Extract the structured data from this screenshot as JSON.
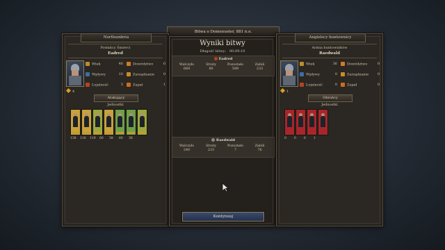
{
  "header": {
    "battle_title": "Bitwa o Domenuster, 881 n.e."
  },
  "left": {
    "faction": "Northumbria",
    "army": "Posłańcy Śmierci",
    "general": "Eadred",
    "stats": [
      {
        "icon": "age-icon",
        "label": "Wiek",
        "value": "46",
        "color": "#b8902f"
      },
      {
        "icon": "influence-icon",
        "label": "Wpływy",
        "value": "10",
        "color": "#3b6fa6"
      },
      {
        "icon": "loyalty-icon",
        "label": "Lojalność",
        "value": "5",
        "color": "#b3451f"
      }
    ],
    "skills": [
      {
        "icon": "command-icon",
        "label": "Dowództwo",
        "value": "6",
        "color": "#d07a2a"
      },
      {
        "icon": "management-icon",
        "label": "Zarządzanie",
        "value": "0",
        "color": "#c78c28"
      },
      {
        "icon": "zeal-icon",
        "label": "Zapał",
        "value": "1",
        "color": "#cf6a1e"
      }
    ],
    "gold": "4",
    "role": "Atakujący",
    "units_label": "Jednostki",
    "unit_counts": [
      "138",
      "116",
      "119",
      "60",
      "58",
      "60",
      "38"
    ]
  },
  "right": {
    "faction": "Angielscy buntownicy",
    "army": "Armia buntowników",
    "general": "Raedwald",
    "stats": [
      {
        "icon": "age-icon",
        "label": "Wiek",
        "value": "36",
        "color": "#b8902f"
      },
      {
        "icon": "influence-icon",
        "label": "Wpływy",
        "value": "0",
        "color": "#3b6fa6"
      },
      {
        "icon": "loyalty-icon",
        "label": "Lojalność",
        "value": "0",
        "color": "#b3451f"
      }
    ],
    "skills": [
      {
        "icon": "command-icon",
        "label": "Dowództwo",
        "value": "0",
        "color": "#d07a2a"
      },
      {
        "icon": "management-icon",
        "label": "Zarządzanie",
        "value": "0",
        "color": "#c78c28"
      },
      {
        "icon": "zeal-icon",
        "label": "Zapał",
        "value": "0",
        "color": "#cf6a1e"
      }
    ],
    "gold": "1",
    "role": "Obrońcy",
    "units_label": "Jednostki",
    "unit_counts": [
      "0",
      "0",
      "6",
      "1"
    ]
  },
  "center": {
    "title": "Wyniki bitwy",
    "duration_label": "Długość bitwy:",
    "duration_value": "00:09:10",
    "headers": [
      "Walczyło",
      "Straty",
      "Pozostało",
      "Zabili"
    ],
    "attacker": {
      "name": "Eadred",
      "values": [
        "669",
        "80",
        "589",
        "233"
      ]
    },
    "defender": {
      "name": "Raedwald",
      "values": [
        "240",
        "233",
        "7",
        "76"
      ]
    }
  },
  "footer": {
    "continue_label": "Kontynuuj"
  }
}
